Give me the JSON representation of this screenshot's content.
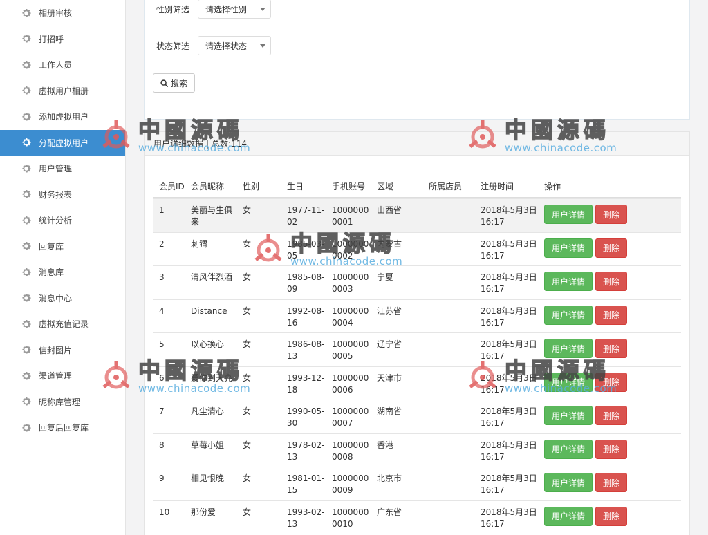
{
  "sidebar": {
    "items": [
      {
        "label": "相册审核",
        "active": false
      },
      {
        "label": "打招呼",
        "active": false
      },
      {
        "label": "工作人员",
        "active": false
      },
      {
        "label": "虚拟用户相册",
        "active": false
      },
      {
        "label": "添加虚拟用户",
        "active": false
      },
      {
        "label": "分配虚拟用户",
        "active": true
      },
      {
        "label": "用户管理",
        "active": false
      },
      {
        "label": "财务报表",
        "active": false
      },
      {
        "label": "统计分析",
        "active": false
      },
      {
        "label": "回复库",
        "active": false
      },
      {
        "label": "消息库",
        "active": false
      },
      {
        "label": "消息中心",
        "active": false
      },
      {
        "label": "虚拟充值记录",
        "active": false
      },
      {
        "label": "信封图片",
        "active": false
      },
      {
        "label": "渠道管理",
        "active": false
      },
      {
        "label": "昵称库管理",
        "active": false
      },
      {
        "label": "回复后回复库",
        "active": false
      }
    ],
    "icon": "gear-icon",
    "active_color": "#3c8dd0"
  },
  "filters": {
    "gender_label": "性别筛选",
    "gender_value": "请选择性别",
    "status_label": "状态筛选",
    "status_value": "请选择状态",
    "search_label": "搜索"
  },
  "table": {
    "title": "用户详细数据",
    "total_label": "总数:114",
    "columns": [
      "会员ID",
      "会员昵称",
      "性别",
      "生日",
      "手机账号",
      "区域",
      "所属店员",
      "注册时间",
      "操作"
    ],
    "detail_label": "用户详情",
    "delete_label": "删除",
    "rows": [
      {
        "id": "1",
        "nick": "美丽与生俱来",
        "sex": "女",
        "birth": "1977-11-02",
        "phone": "10000000001",
        "region": "山西省",
        "store": "",
        "reg": "2018年5月3日 16:17"
      },
      {
        "id": "2",
        "nick": "刺猬",
        "sex": "女",
        "birth": "1985-03-05",
        "phone": "10000000002",
        "region": "内蒙古",
        "store": "",
        "reg": "2018年5月3日 16:17"
      },
      {
        "id": "3",
        "nick": "清风伴烈酒",
        "sex": "女",
        "birth": "1985-08-09",
        "phone": "10000000003",
        "region": "宁夏",
        "store": "",
        "reg": "2018年5月3日 16:17"
      },
      {
        "id": "4",
        "nick": "Distance",
        "sex": "女",
        "birth": "1992-08-16",
        "phone": "10000000004",
        "region": "江苏省",
        "store": "",
        "reg": "2018年5月3日 16:17"
      },
      {
        "id": "5",
        "nick": "以心换心",
        "sex": "女",
        "birth": "1986-08-13",
        "phone": "10000000005",
        "region": "辽宁省",
        "store": "",
        "reg": "2018年5月3日 16:17"
      },
      {
        "id": "6",
        "nick": "爱你到天亮",
        "sex": "女",
        "birth": "1993-12-18",
        "phone": "10000000006",
        "region": "天津市",
        "store": "",
        "reg": "2018年5月3日 16:17"
      },
      {
        "id": "7",
        "nick": "凡尘清心",
        "sex": "女",
        "birth": "1990-05-30",
        "phone": "10000000007",
        "region": "湖南省",
        "store": "",
        "reg": "2018年5月3日 16:17"
      },
      {
        "id": "8",
        "nick": "草莓小姐",
        "sex": "女",
        "birth": "1978-02-13",
        "phone": "10000000008",
        "region": "香港",
        "store": "",
        "reg": "2018年5月3日 16:17"
      },
      {
        "id": "9",
        "nick": "相见恨晚",
        "sex": "女",
        "birth": "1981-01-15",
        "phone": "10000000009",
        "region": "北京市",
        "store": "",
        "reg": "2018年5月3日 16:17"
      },
      {
        "id": "10",
        "nick": "那份爱",
        "sex": "女",
        "birth": "1993-02-13",
        "phone": "10000000010",
        "region": "广东省",
        "store": "",
        "reg": "2018年5月3日 16:17"
      }
    ]
  },
  "watermark": {
    "cn": "中國源碼",
    "en": "www.chinacode.com"
  }
}
